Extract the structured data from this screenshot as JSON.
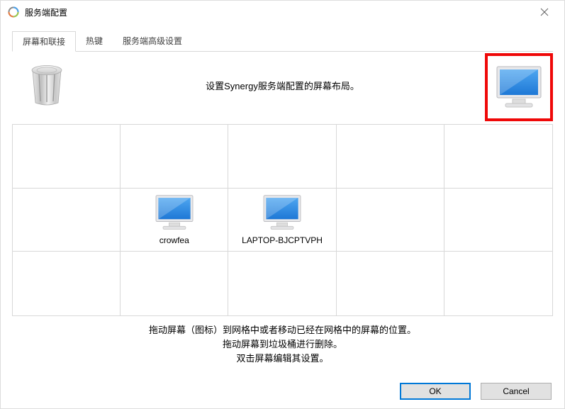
{
  "titlebar": {
    "title": "服务端配置"
  },
  "tabs": {
    "screens": "屏幕和联接",
    "hotkeys": "热键",
    "advanced": "服务端高级设置"
  },
  "header": {
    "instruction": "设置Synergy服务端配置的屏幕布局。"
  },
  "screens": {
    "a": "crowfea",
    "b": "LAPTOP-BJCPTVPH"
  },
  "help": {
    "line1": "拖动屏幕（图标）到网格中或者移动已经在网格中的屏幕的位置。",
    "line2": "拖动屏幕到垃圾桶进行删除。",
    "line3": "双击屏幕编辑其设置。"
  },
  "buttons": {
    "ok": "OK",
    "cancel": "Cancel"
  }
}
